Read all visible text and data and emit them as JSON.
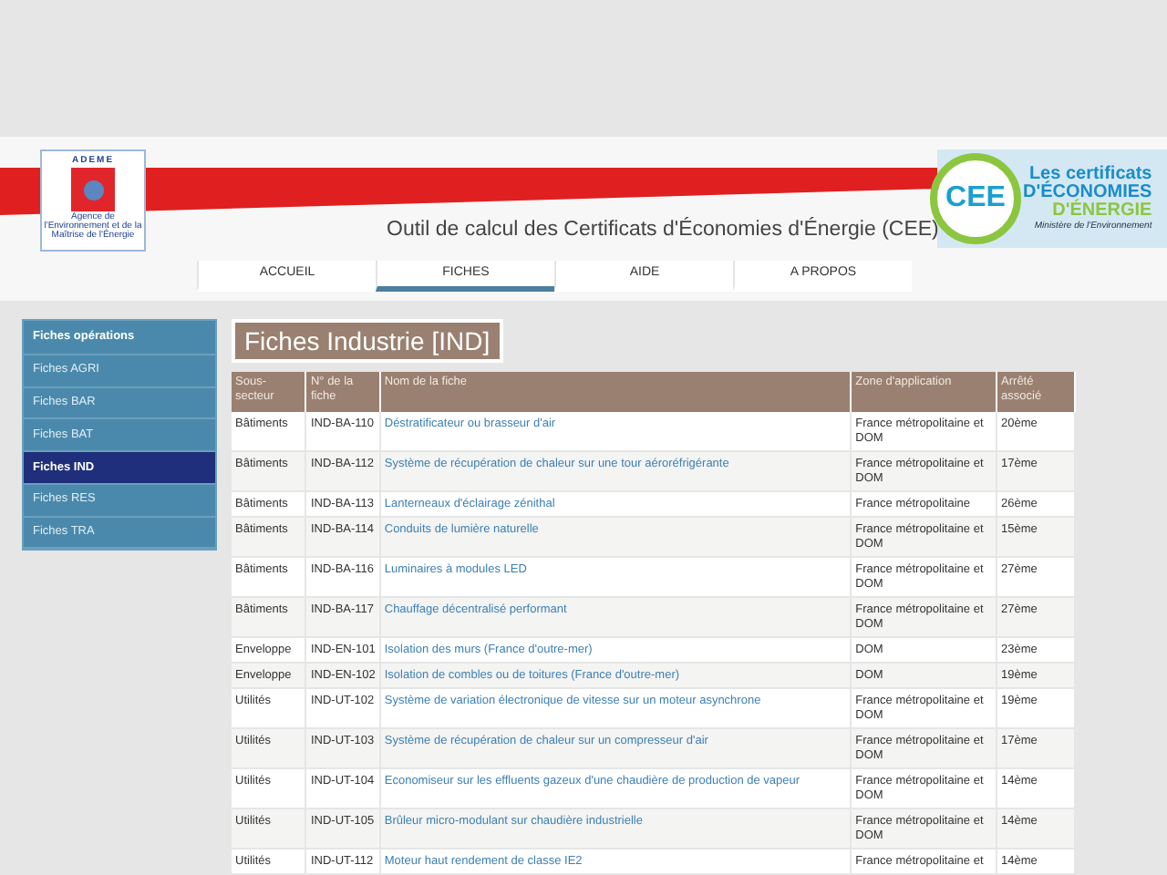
{
  "header": {
    "logo_left": {
      "name": "ADEME",
      "caption": "Agence de l'Environnement et de la Maîtrise de l'Énergie"
    },
    "title": "Outil de calcul des Certificats d'Économies d'Énergie (CEE)",
    "logo_right": {
      "badge": "CEE",
      "line_1": "Les certificats",
      "line_2": "D'ÉCONOMIES",
      "line_3": "D'ÉNERGIE",
      "caption": "Ministère de l'Environnement"
    }
  },
  "nav": [
    {
      "label": "ACCUEIL",
      "selected": false
    },
    {
      "label": "FICHES",
      "selected": true
    },
    {
      "label": "AIDE",
      "selected": false
    },
    {
      "label": "A PROPOS",
      "selected": false
    }
  ],
  "sidebar": {
    "title": "Fiches opérations",
    "items": [
      {
        "label": "Fiches AGRI",
        "selected": false
      },
      {
        "label": "Fiches BAR",
        "selected": false
      },
      {
        "label": "Fiches BAT",
        "selected": false
      },
      {
        "label": "Fiches IND",
        "selected": true
      },
      {
        "label": "Fiches RES",
        "selected": false
      },
      {
        "label": "Fiches TRA",
        "selected": false
      }
    ]
  },
  "page_title": "Fiches Industrie [IND]",
  "table": {
    "columns": [
      "Sous-secteur",
      "N° de la fiche",
      "Nom de la fiche",
      "Zone d'application",
      "Arrêté associé"
    ],
    "rows": [
      [
        "Bâtiments",
        "IND-BA-110",
        "Déstratificateur ou brasseur d'air",
        "France métropolitaine et DOM",
        "20ème"
      ],
      [
        "Bâtiments",
        "IND-BA-112",
        "Système de récupération de chaleur sur une tour aéroréfrigérante",
        "France métropolitaine et DOM",
        "17ème"
      ],
      [
        "Bâtiments",
        "IND-BA-113",
        "Lanterneaux d'éclairage zénithal",
        "France métropolitaine",
        "26ème"
      ],
      [
        "Bâtiments",
        "IND-BA-114",
        "Conduits de lumière naturelle",
        "France métropolitaine et DOM",
        "15ème"
      ],
      [
        "Bâtiments",
        "IND-BA-116",
        "Luminaires à modules LED",
        "France métropolitaine et DOM",
        "27ème"
      ],
      [
        "Bâtiments",
        "IND-BA-117",
        "Chauffage décentralisé performant",
        "France métropolitaine et DOM",
        "27ème"
      ],
      [
        "Enveloppe",
        "IND-EN-101",
        "Isolation des murs (France d'outre-mer)",
        "DOM",
        "23ème"
      ],
      [
        "Enveloppe",
        "IND-EN-102",
        "Isolation de combles ou de toitures (France d'outre-mer)",
        "DOM",
        "19ème"
      ],
      [
        "Utilités",
        "IND-UT-102",
        "Système de variation électronique de vitesse sur un moteur asynchrone",
        "France métropolitaine et DOM",
        "19ème"
      ],
      [
        "Utilités",
        "IND-UT-103",
        "Système de récupération de chaleur sur un compresseur d'air",
        "France métropolitaine et DOM",
        "17ème"
      ],
      [
        "Utilités",
        "IND-UT-104",
        "Economiseur sur les effluents gazeux d'une chaudière de production de vapeur",
        "France métropolitaine et DOM",
        "14ème"
      ],
      [
        "Utilités",
        "IND-UT-105",
        "Brûleur micro-modulant sur chaudière industrielle",
        "France métropolitaine et DOM",
        "14ème"
      ],
      [
        "Utilités",
        "IND-UT-112",
        "Moteur haut rendement de classe IE2",
        "France métropolitaine et",
        "14ème"
      ]
    ]
  }
}
